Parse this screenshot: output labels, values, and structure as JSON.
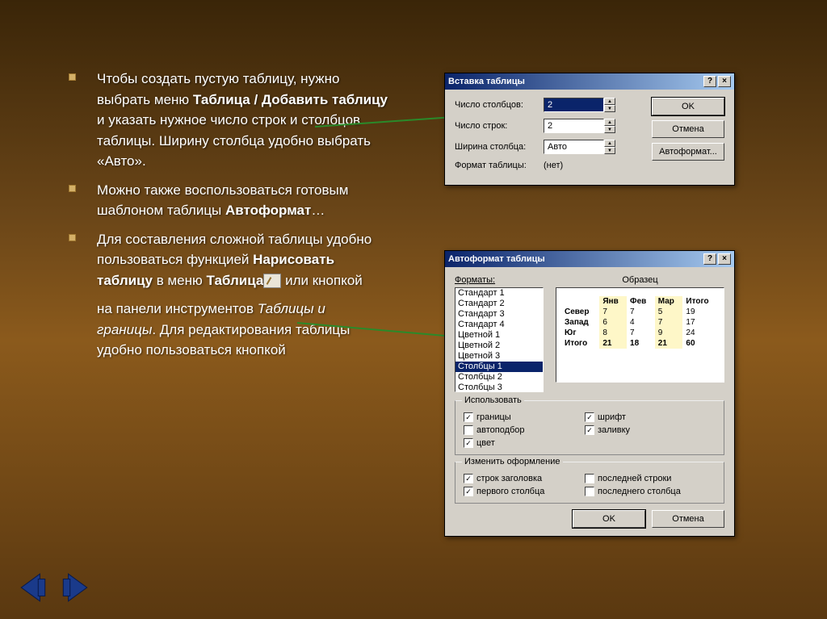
{
  "bullets": {
    "b1_p1": "Чтобы создать пустую таблицу, нужно выбрать меню ",
    "b1_bold1": "Таблица / Добавить таблицу",
    "b1_p2": " и указать нужное число строк и столбцов таблицы. Ширину столбца удобно выбрать «Авто».",
    "b2_p1": "Можно также воспользоваться готовым шаблоном таблицы ",
    "b2_bold": "Автоформат",
    "b2_p2": "…",
    "b3_p1": "Для составления сложной таблицы удобно пользоваться функцией ",
    "b3_bold1": "Нарисовать таблицу",
    "b3_p2": " в меню ",
    "b3_bold2": "Таблица",
    "b3_p3": " или кнопкой",
    "b3_cont_p1": " на панели инструментов ",
    "b3_ital": "Таблицы и границы",
    "b3_cont_p2": ". Для редактирования таблицы удобно пользоваться кнопкой"
  },
  "dlg1": {
    "title": "Вставка таблицы",
    "rows": {
      "cols_label": "Число столбцов:",
      "cols_val": "2",
      "rows_label": "Число строк:",
      "rows_val": "2",
      "width_label": "Ширина столбца:",
      "width_val": "Авто",
      "format_label": "Формат таблицы:",
      "format_val": "(нет)"
    },
    "buttons": {
      "ok": "OK",
      "cancel": "Отмена",
      "autoformat": "Автоформат..."
    }
  },
  "dlg2": {
    "title": "Автоформат таблицы",
    "formats_label": "Форматы:",
    "preview_label": "Образец",
    "formats": [
      "Стандарт 1",
      "Стандарт 2",
      "Стандарт 3",
      "Стандарт 4",
      "Цветной 1",
      "Цветной 2",
      "Цветной 3",
      "Столбцы 1",
      "Столбцы 2",
      "Столбцы 3"
    ],
    "selected_format_index": 7,
    "preview_table": {
      "headers": [
        "",
        "Янв",
        "Фев",
        "Мар",
        "Итого"
      ],
      "rows": [
        [
          "Север",
          "7",
          "7",
          "5",
          "19"
        ],
        [
          "Запад",
          "6",
          "4",
          "7",
          "17"
        ],
        [
          "Юг",
          "8",
          "7",
          "9",
          "24"
        ],
        [
          "Итого",
          "21",
          "18",
          "21",
          "60"
        ]
      ]
    },
    "group_use": {
      "title": "Использовать",
      "checks": [
        {
          "label": "границы",
          "checked": true
        },
        {
          "label": "шрифт",
          "checked": true
        },
        {
          "label": "автоподбор",
          "checked": false
        },
        {
          "label": "заливку",
          "checked": true
        },
        {
          "label": "цвет",
          "checked": true
        }
      ]
    },
    "group_apply": {
      "title": "Изменить оформление",
      "checks": [
        {
          "label": "строк заголовка",
          "checked": true
        },
        {
          "label": "последней строки",
          "checked": false
        },
        {
          "label": "первого столбца",
          "checked": true
        },
        {
          "label": "последнего столбца",
          "checked": false
        }
      ]
    },
    "buttons": {
      "ok": "OK",
      "cancel": "Отмена"
    }
  }
}
